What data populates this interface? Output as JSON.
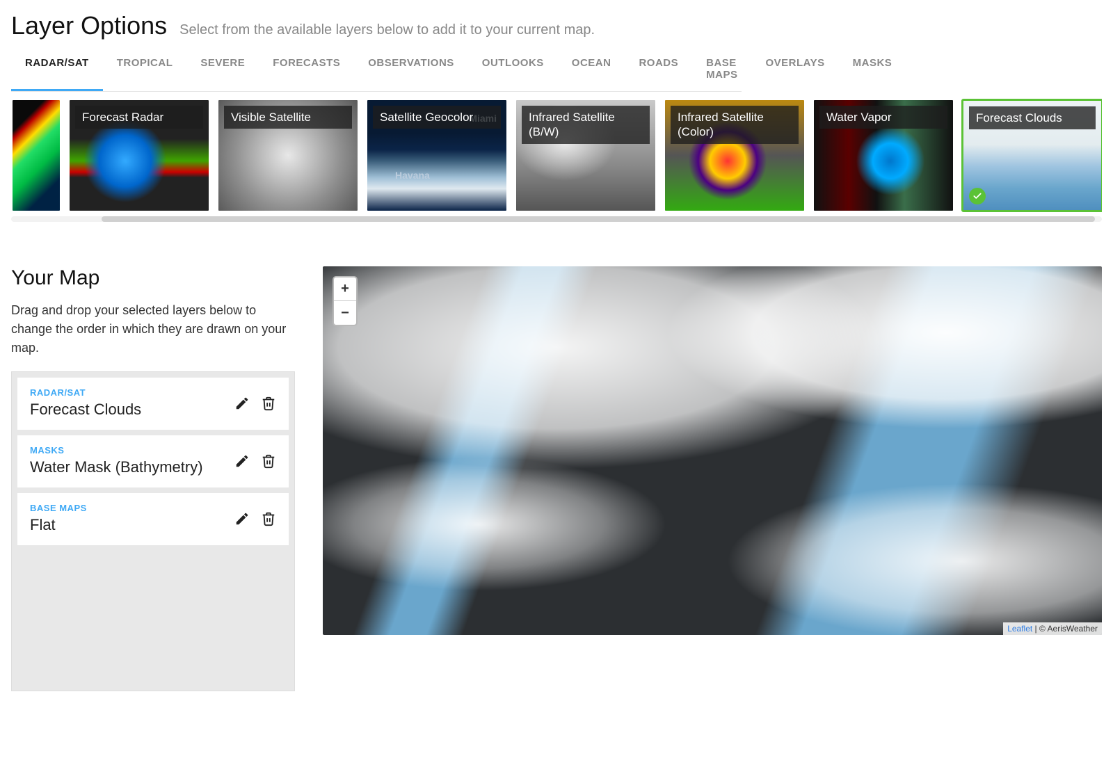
{
  "header": {
    "title": "Layer Options",
    "subtitle": "Select from the available layers below to add it to your current map."
  },
  "tabs": [
    {
      "label": "RADAR/SAT",
      "active": true
    },
    {
      "label": "TROPICAL",
      "active": false
    },
    {
      "label": "SEVERE",
      "active": false
    },
    {
      "label": "FORECASTS",
      "active": false
    },
    {
      "label": "OBSERVATIONS",
      "active": false
    },
    {
      "label": "OUTLOOKS",
      "active": false
    },
    {
      "label": "OCEAN",
      "active": false
    },
    {
      "label": "ROADS",
      "active": false
    },
    {
      "label": "BASE MAPS",
      "active": false
    },
    {
      "label": "OVERLAYS",
      "active": false
    },
    {
      "label": "MASKS",
      "active": false
    }
  ],
  "layer_cards": [
    {
      "label": "",
      "thumb": "radar-sliver",
      "selected": false
    },
    {
      "label": "Forecast Radar",
      "thumb": "forecast-radar",
      "selected": false
    },
    {
      "label": "Visible Satellite",
      "thumb": "visible-sat",
      "selected": false
    },
    {
      "label": "Satellite Geocolor",
      "thumb": "geocolor",
      "selected": false,
      "cities": [
        "Miami",
        "Havana"
      ]
    },
    {
      "label": "Infrared Satellite (B/W)",
      "thumb": "ir-bw",
      "selected": false
    },
    {
      "label": "Infrared Satellite (Color)",
      "thumb": "ir-color",
      "selected": false
    },
    {
      "label": "Water Vapor",
      "thumb": "water-vapor",
      "selected": false
    },
    {
      "label": "Forecast Clouds",
      "thumb": "forecast-clouds",
      "selected": true
    }
  ],
  "your_map": {
    "title": "Your Map",
    "description": "Drag and drop your selected layers below to change the order in which they are drawn on your map.",
    "layers": [
      {
        "category": "RADAR/SAT",
        "name": "Forecast Clouds"
      },
      {
        "category": "MASKS",
        "name": "Water Mask (Bathymetry)"
      },
      {
        "category": "BASE MAPS",
        "name": "Flat"
      }
    ]
  },
  "map": {
    "zoom_in": "+",
    "zoom_out": "−",
    "attribution_link": "Leaflet",
    "attribution_text": " | © AerisWeather"
  }
}
